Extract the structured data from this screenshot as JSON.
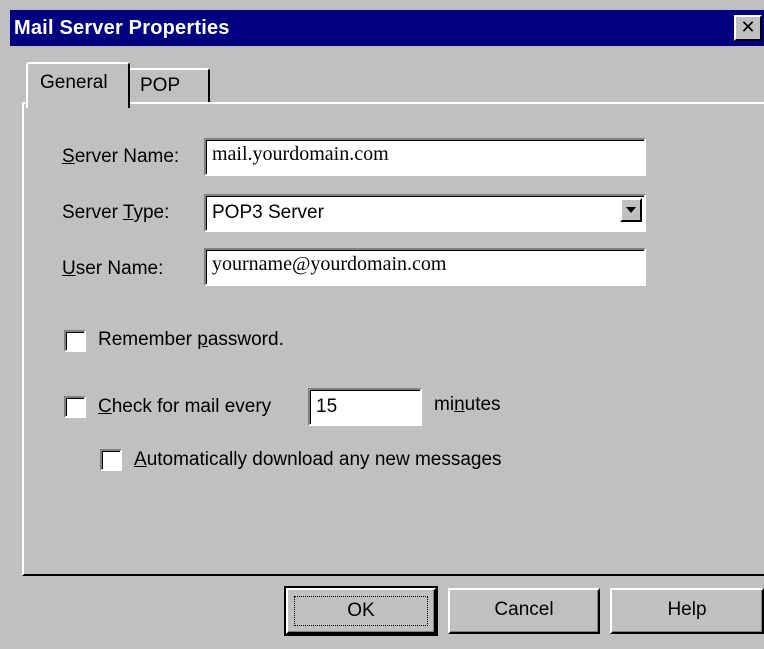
{
  "window": {
    "title": "Mail Server Properties",
    "close_glyph": "✕"
  },
  "tabs": [
    {
      "label": "General",
      "active": true
    },
    {
      "label": "POP",
      "active": false
    }
  ],
  "form": {
    "server_name": {
      "label_u": "S",
      "label_rest": "erver Name:",
      "value": "mail.yourdomain.com"
    },
    "server_type": {
      "label_pre": "Server ",
      "label_u": "T",
      "label_rest": "ype:",
      "value": "POP3 Server"
    },
    "user_name": {
      "label_u": "U",
      "label_rest": "ser Name:",
      "value": "yourname@yourdomain.com"
    },
    "remember_password": {
      "label_pre": "Remember ",
      "label_u": "p",
      "label_rest": "assword.",
      "checked": false
    },
    "check_mail": {
      "label_pre": "",
      "label_u": "C",
      "label_rest": "heck for mail every",
      "interval": "15",
      "unit_pre": "mi",
      "unit_u": "n",
      "unit_rest": "utes",
      "checked": false
    },
    "auto_download": {
      "label_u": "A",
      "label_rest": "utomatically download any new messages",
      "checked": false
    }
  },
  "buttons": {
    "ok": "OK",
    "cancel": "Cancel",
    "help": "Help"
  },
  "colors": {
    "titlebar": "#000080",
    "face": "#c0c0c0"
  }
}
